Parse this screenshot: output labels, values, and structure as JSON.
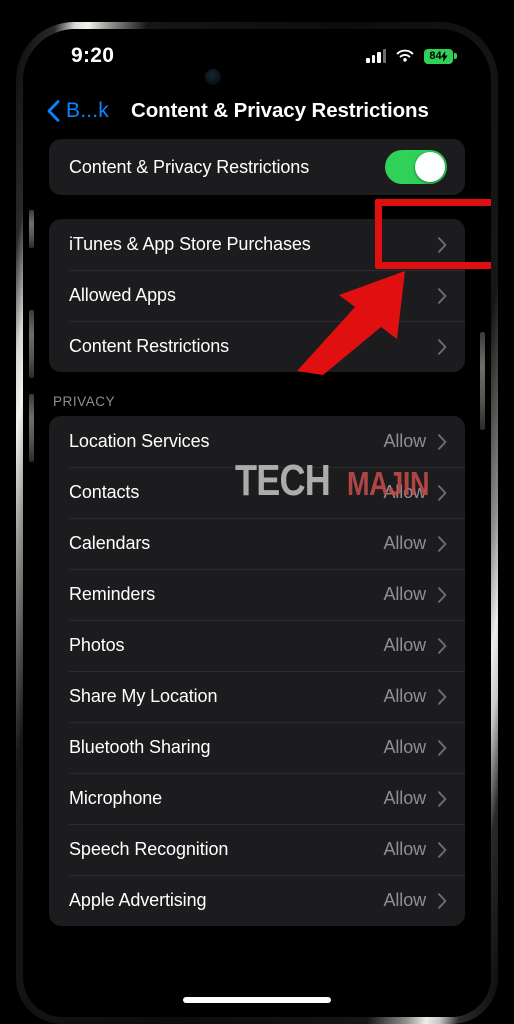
{
  "status_bar": {
    "time": "9:20",
    "signal_icon": "cellular-signal-icon",
    "wifi_icon": "wifi-icon",
    "battery_level": "84",
    "battery_charging": true,
    "battery_color": "#30D158"
  },
  "nav": {
    "back_label": "B...k",
    "back_icon": "chevron-left-icon",
    "title": "Content & Privacy Restrictions",
    "accent_color": "#0A84FF"
  },
  "toggle_row": {
    "label": "Content & Privacy Restrictions",
    "enabled": true,
    "switch_on_color": "#30D158"
  },
  "menu_group": {
    "items": [
      {
        "label": "iTunes & App Store Purchases"
      },
      {
        "label": "Allowed Apps"
      },
      {
        "label": "Content Restrictions"
      }
    ]
  },
  "privacy_section": {
    "header": "PRIVACY",
    "items": [
      {
        "label": "Location Services",
        "value": "Allow"
      },
      {
        "label": "Contacts",
        "value": "Allow"
      },
      {
        "label": "Calendars",
        "value": "Allow"
      },
      {
        "label": "Reminders",
        "value": "Allow"
      },
      {
        "label": "Photos",
        "value": "Allow"
      },
      {
        "label": "Share My Location",
        "value": "Allow"
      },
      {
        "label": "Bluetooth Sharing",
        "value": "Allow"
      },
      {
        "label": "Microphone",
        "value": "Allow"
      },
      {
        "label": "Speech Recognition",
        "value": "Allow"
      },
      {
        "label": "Apple Advertising",
        "value": "Allow"
      }
    ]
  },
  "watermark": {
    "part1": "TECH",
    "part2": "MAJIN",
    "part1_color": "#b9b9b9",
    "part2_color": "#c14a4a"
  },
  "annotations": {
    "highlight_color": "#E01010",
    "box_target": "content-privacy-restrictions-toggle",
    "arrow_target": "content-privacy-restrictions-toggle"
  }
}
